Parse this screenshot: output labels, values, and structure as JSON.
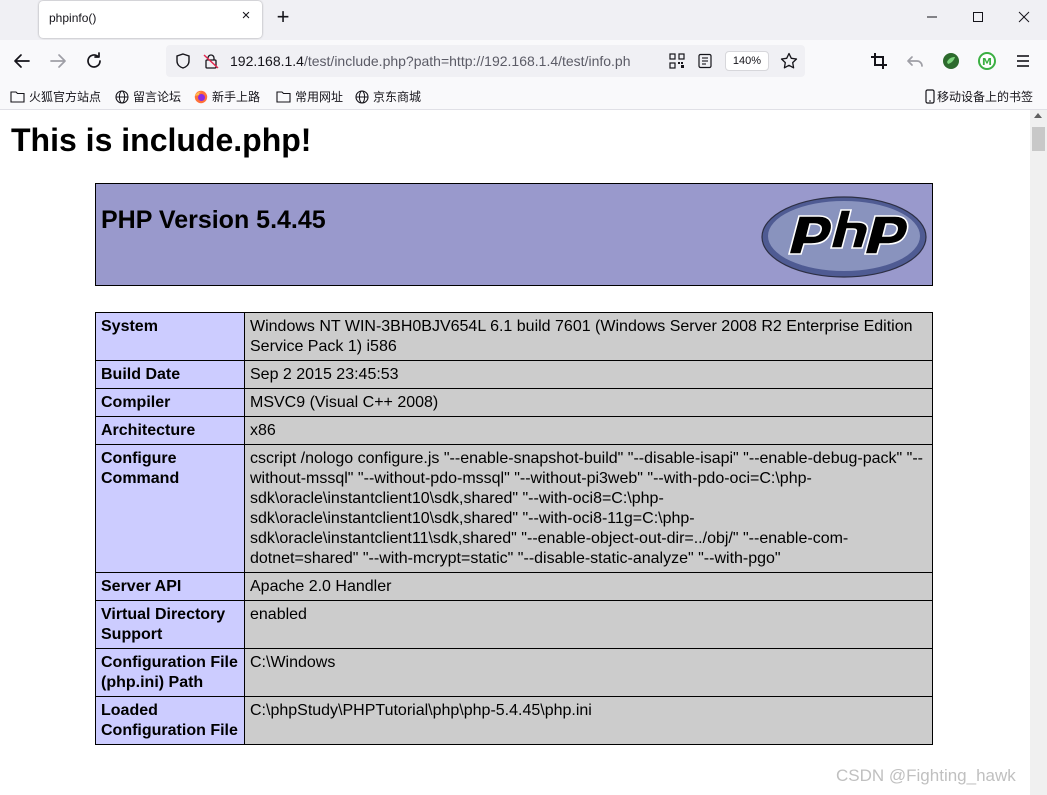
{
  "browser": {
    "tab_title": "phpinfo()",
    "tab_close": "×",
    "new_tab": "+",
    "url_host": "192.168.1.4",
    "url_rest": "/test/include.php?path=http://192.168.1.4/test/info.ph",
    "zoom": "140%"
  },
  "bookmarks": [
    {
      "label": "火狐官方站点",
      "icon": "folder-icon"
    },
    {
      "label": "留言论坛",
      "icon": "globe-icon"
    },
    {
      "label": "新手上路",
      "icon": "firefox-icon"
    },
    {
      "label": "常用网址",
      "icon": "folder-icon"
    },
    {
      "label": "京东商城",
      "icon": "globe-icon"
    }
  ],
  "mobile_bookmarks": "移动设备上的书签",
  "page": {
    "heading": "This is include.php!",
    "php_version": "PHP Version 5.4.45",
    "rows": [
      {
        "key": "System",
        "value": "Windows NT WIN-3BH0BJV654L 6.1 build 7601 (Windows Server 2008 R2 Enterprise Edition Service Pack 1) i586"
      },
      {
        "key": "Build Date",
        "value": "Sep 2 2015 23:45:53"
      },
      {
        "key": "Compiler",
        "value": "MSVC9 (Visual C++ 2008)"
      },
      {
        "key": "Architecture",
        "value": "x86"
      },
      {
        "key": "Configure Command",
        "value": "cscript /nologo configure.js \"--enable-snapshot-build\" \"--disable-isapi\" \"--enable-debug-pack\" \"--without-mssql\" \"--without-pdo-mssql\" \"--without-pi3web\" \"--with-pdo-oci=C:\\php-sdk\\oracle\\instantclient10\\sdk,shared\" \"--with-oci8=C:\\php-sdk\\oracle\\instantclient10\\sdk,shared\" \"--with-oci8-11g=C:\\php-sdk\\oracle\\instantclient11\\sdk,shared\" \"--enable-object-out-dir=../obj/\" \"--enable-com-dotnet=shared\" \"--with-mcrypt=static\" \"--disable-static-analyze\" \"--with-pgo\""
      },
      {
        "key": "Server API",
        "value": "Apache 2.0 Handler"
      },
      {
        "key": "Virtual Directory Support",
        "value": "enabled"
      },
      {
        "key": "Configuration File (php.ini) Path",
        "value": "C:\\Windows"
      },
      {
        "key": "Loaded Configuration File",
        "value": "C:\\phpStudy\\PHPTutorial\\php\\php-5.4.45\\php.ini"
      }
    ]
  },
  "watermark": "CSDN @Fighting_hawk",
  "colors": {
    "header_bg": "#9999cc",
    "key_cell_bg": "#ccccff",
    "value_cell_bg": "#cccccc"
  }
}
